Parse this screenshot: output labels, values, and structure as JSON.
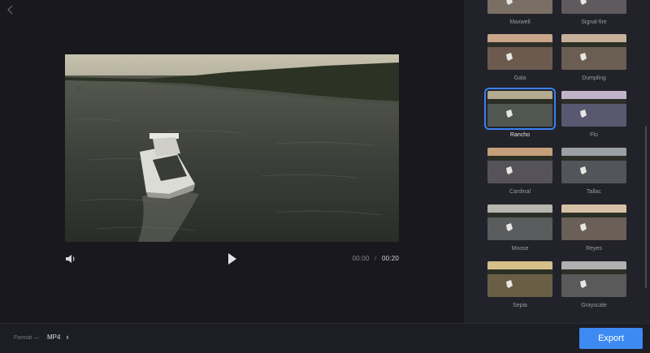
{
  "time": {
    "current": "00:00",
    "separator": "/",
    "total": "00:20"
  },
  "filters": [
    {
      "name": "Maxwell",
      "tone": "#7a6f64",
      "sky": "#b09a8a"
    },
    {
      "name": "Signal-fire",
      "tone": "#5e5a5e",
      "sky": "#9c8e88"
    },
    {
      "name": "Gala",
      "tone": "#6c5a4e",
      "sky": "#c9a58a"
    },
    {
      "name": "Dumpling",
      "tone": "#6a5e52",
      "sky": "#c7b09a"
    },
    {
      "name": "Rancho",
      "tone": "#505650",
      "sky": "#b3aa90",
      "selected": true
    },
    {
      "name": "Flo",
      "tone": "#5a5870",
      "sky": "#c2b4c8"
    },
    {
      "name": "Cardinal",
      "tone": "#55525a",
      "sky": "#c4a07a"
    },
    {
      "name": "Tallac",
      "tone": "#52555a",
      "sky": "#9aa0a6"
    },
    {
      "name": "Moose",
      "tone": "#5a5c5e",
      "sky": "#b8b4ae"
    },
    {
      "name": "Reyes",
      "tone": "#6a6058",
      "sky": "#d6c0a6"
    },
    {
      "name": "Sepia",
      "tone": "#6a5e46",
      "sky": "#d6c08a"
    },
    {
      "name": "Grayscale",
      "tone": "#5a5a5a",
      "sky": "#b0b0b0"
    }
  ],
  "footer": {
    "format_label": "Format —",
    "format_value": "MP4",
    "export_label": "Export"
  },
  "colors": {
    "accent": "#3d8af2",
    "selection": "#3a82f0"
  }
}
